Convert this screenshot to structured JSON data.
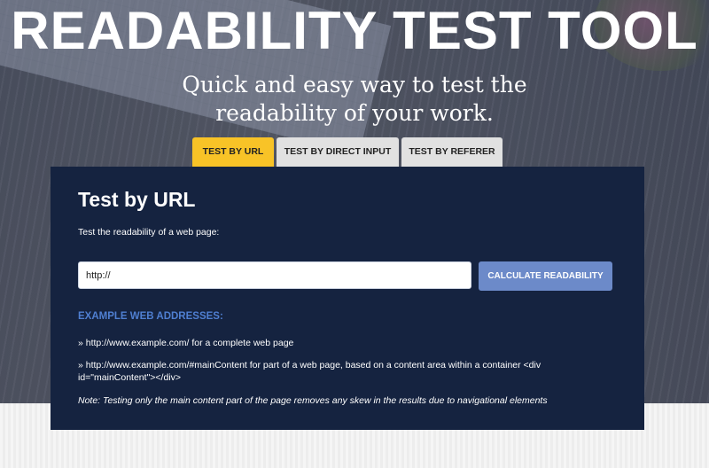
{
  "hero": {
    "title": "READABILITY TEST TOOL",
    "tagline_line1": "Quick and easy way to test the",
    "tagline_line2": "readability of your work."
  },
  "tabs": [
    {
      "label": "TEST BY URL",
      "active": true
    },
    {
      "label": "TEST BY DIRECT INPUT",
      "active": false
    },
    {
      "label": "TEST BY REFERER",
      "active": false
    }
  ],
  "panel": {
    "title": "Test by URL",
    "subtitle": "Test the readability of a web page:",
    "url_value": "http://",
    "button_label": "CALCULATE READABILITY",
    "examples_heading": "EXAMPLE WEB ADDRESSES:",
    "example_1": "» http://www.example.com/ for a complete web page",
    "example_2": "» http://www.example.com/#mainContent for part of a web page, based on a content area within a container <div id=\"mainContent\"></div>",
    "note": "Note: Testing only the main content part of the page removes any skew in the results due to navigational elements"
  },
  "colors": {
    "accent_tab": "#f8c327",
    "panel_bg": "#152340",
    "button_bg": "#6c8ac9",
    "examples_heading": "#4f7fd1"
  }
}
